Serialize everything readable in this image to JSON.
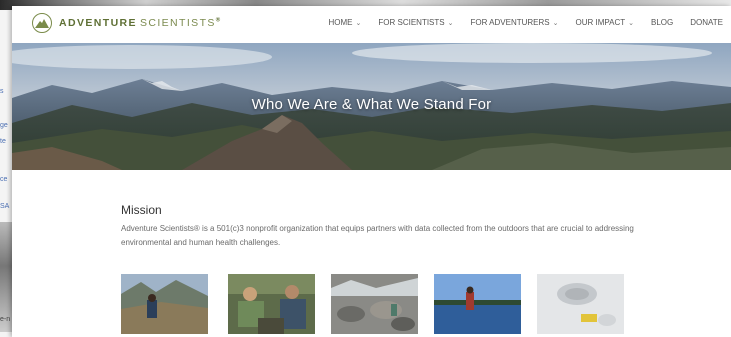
{
  "background_sidebar": {
    "fragments": [
      "s",
      "ge",
      "te",
      "ce",
      "SA",
      "e-n"
    ]
  },
  "brand": {
    "name_bold": "ADVENTURE",
    "name_light": "SCIENTISTS",
    "mark": "®",
    "logo_icon": "mountain-logo-icon",
    "color": "#5f7035"
  },
  "nav": {
    "items": [
      {
        "label": "HOME",
        "dropdown": true
      },
      {
        "label": "FOR SCIENTISTS",
        "dropdown": true
      },
      {
        "label": "FOR ADVENTURERS",
        "dropdown": true
      },
      {
        "label": "OUR IMPACT",
        "dropdown": true
      },
      {
        "label": "BLOG",
        "dropdown": false
      },
      {
        "label": "DONATE",
        "dropdown": false
      }
    ],
    "chevron": "⌄"
  },
  "hero": {
    "title": "Who We Are & What We Stand For"
  },
  "mission": {
    "heading": "Mission",
    "body": "Adventure Scientists® is a 501(c)3 nonprofit organization that equips partners with data collected from the outdoors that are crucial to addressing environmental and human health challenges."
  },
  "gallery": {
    "images": [
      "mountain-valley-photo",
      "field-researchers-photo",
      "rocky-stream-photo",
      "kayaker-lake-photo",
      "snow-sample-photo"
    ]
  }
}
